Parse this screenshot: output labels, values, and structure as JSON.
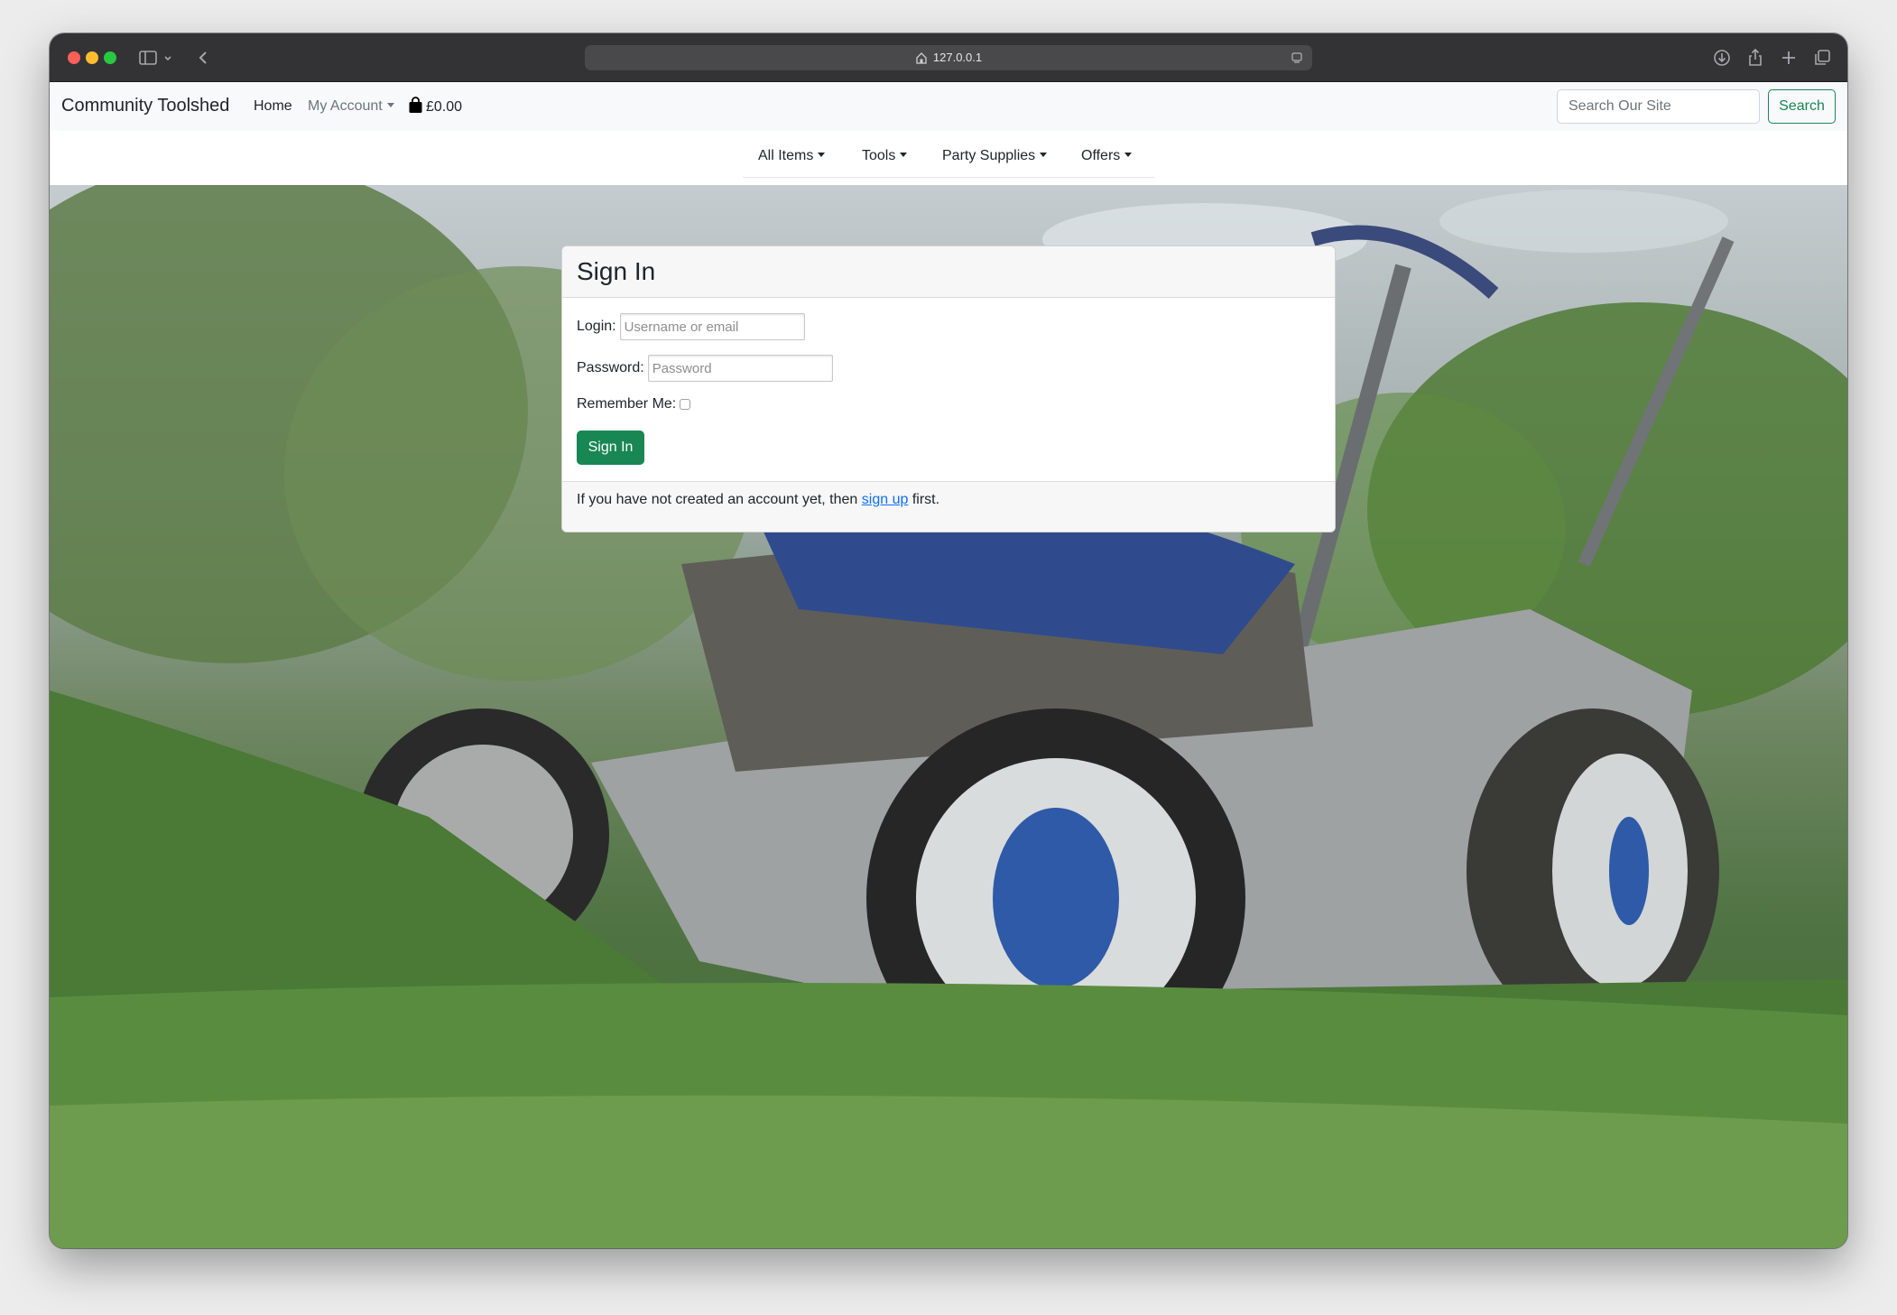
{
  "browser": {
    "url": "127.0.0.1",
    "icons": [
      "sidebar-icon",
      "chevron-down-icon",
      "back-icon",
      "download-icon",
      "share-icon",
      "new-tab-icon",
      "tab-overview-icon"
    ]
  },
  "navbar": {
    "brand": "Community Toolshed",
    "home": "Home",
    "account": "My Account",
    "cart_total": "£0.00",
    "search_placeholder": "Search Our Site",
    "search_button": "Search"
  },
  "categories": [
    "All Items",
    "Tools",
    "Party Supplies",
    "Offers"
  ],
  "signin": {
    "title": "Sign In",
    "login_label": "Login:",
    "login_placeholder": "Username or email",
    "password_label": "Password:",
    "password_placeholder": "Password",
    "remember_label": "Remember Me:",
    "remember_checked": false,
    "submit": "Sign In",
    "footer_prefix": "If you have not created an account yet, then",
    "footer_link": "sign up",
    "footer_suffix": "first."
  },
  "colors": {
    "primary_green": "#198754",
    "link_blue": "#0d6efd",
    "navbar_bg": "#f8f9fa"
  }
}
